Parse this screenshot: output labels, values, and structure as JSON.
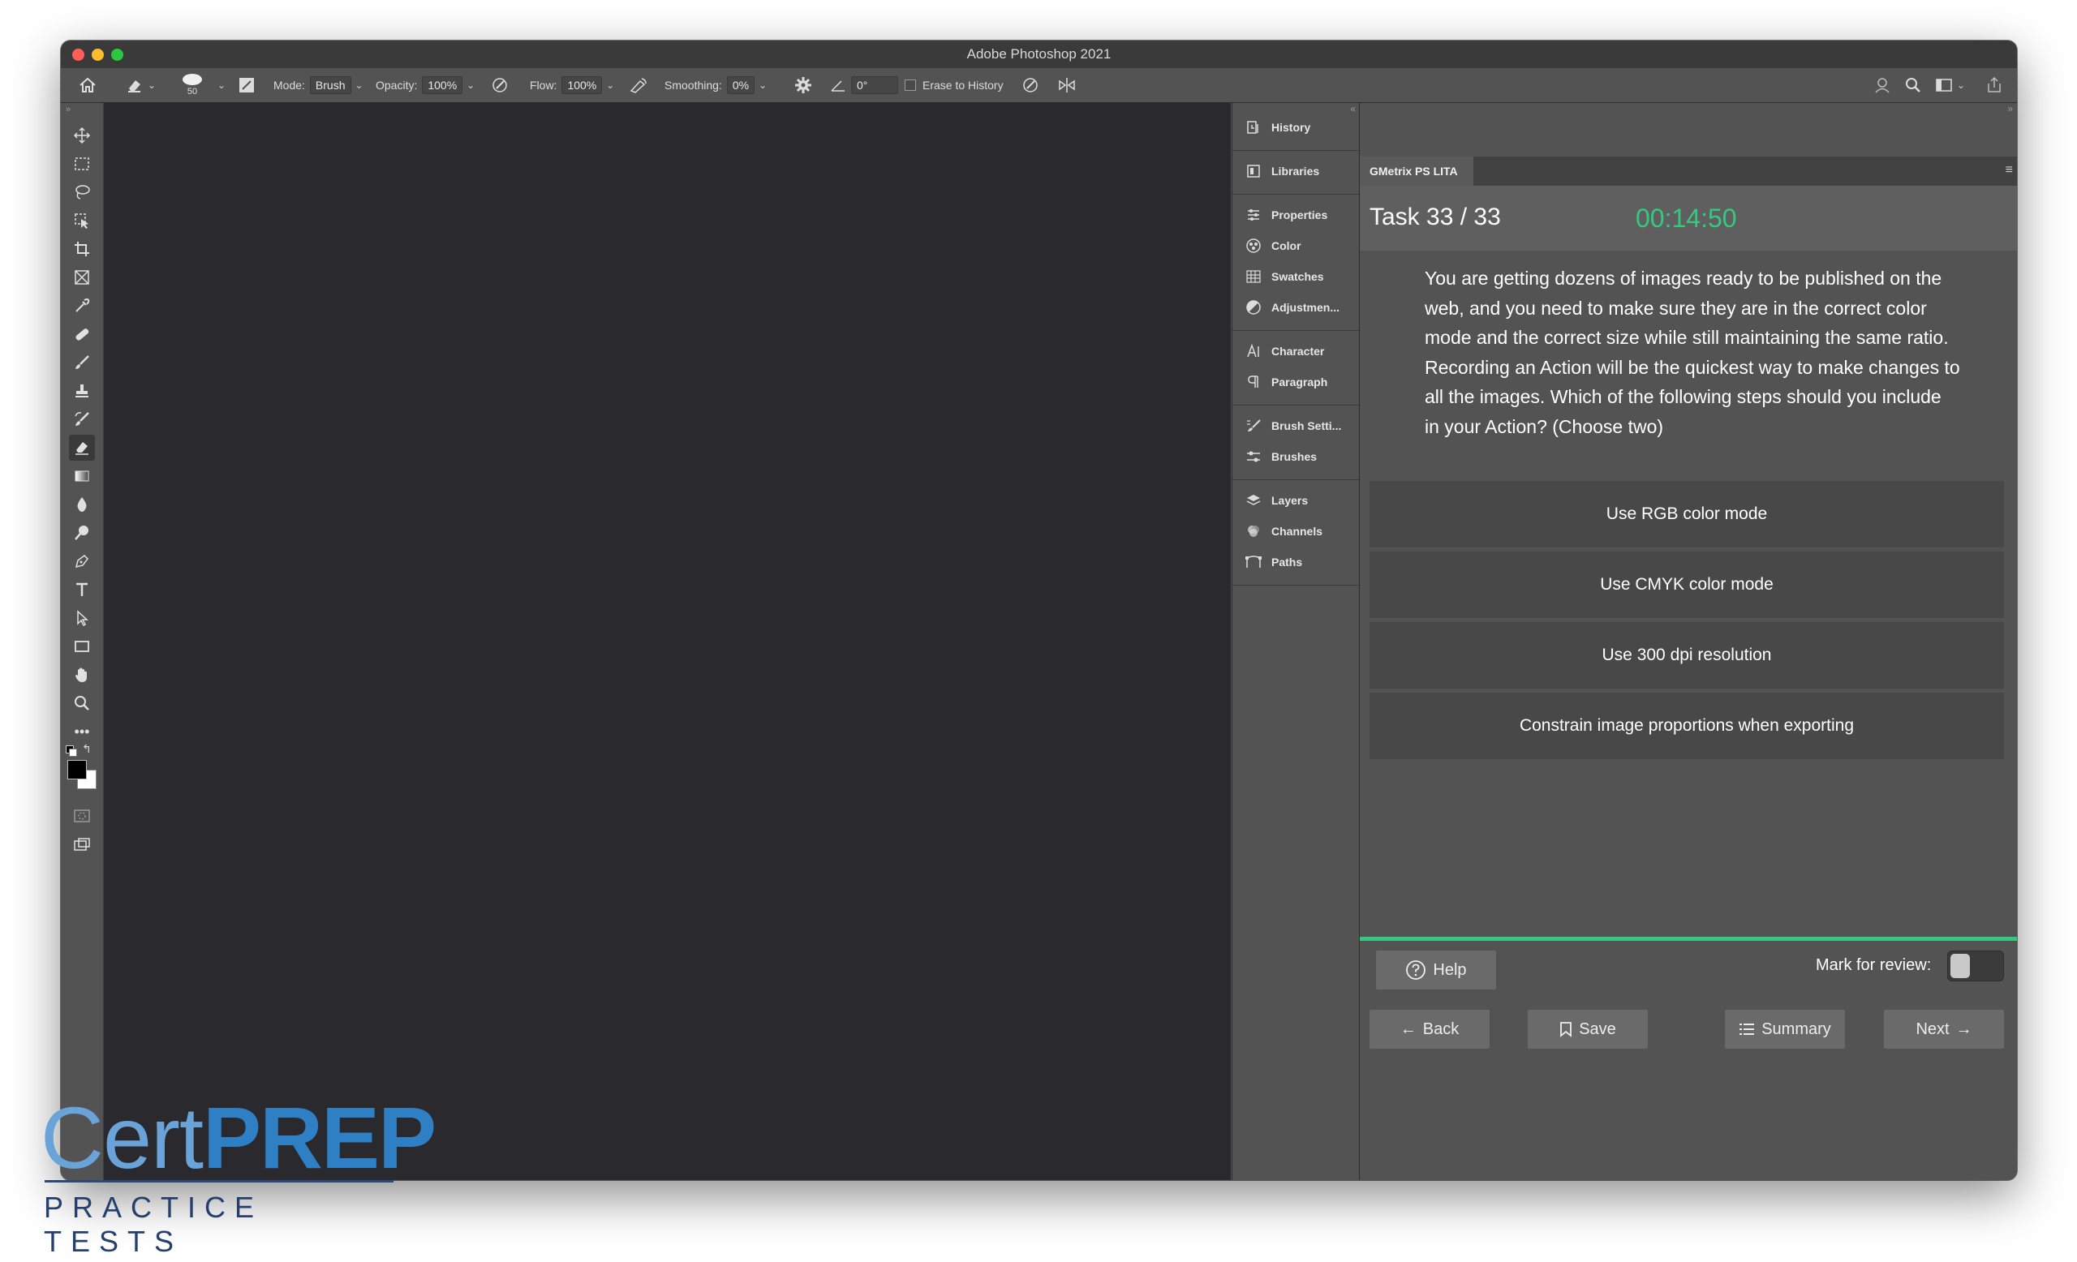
{
  "window": {
    "title": "Adobe Photoshop 2021"
  },
  "options_bar": {
    "brush_size": "50",
    "mode_label": "Mode:",
    "mode_value": "Brush",
    "opacity_label": "Opacity:",
    "opacity_value": "100%",
    "flow_label": "Flow:",
    "flow_value": "100%",
    "smoothing_label": "Smoothing:",
    "smoothing_value": "0%",
    "angle_value": "0°",
    "erase_to_history_label": "Erase to History"
  },
  "panel_dock": {
    "items": [
      {
        "label": "History",
        "icon": "history-icon"
      },
      {
        "label": "Libraries",
        "icon": "libraries-icon"
      },
      {
        "label": "Properties",
        "icon": "properties-icon"
      },
      {
        "label": "Color",
        "icon": "color-icon"
      },
      {
        "label": "Swatches",
        "icon": "swatches-icon"
      },
      {
        "label": "Adjustmen...",
        "icon": "adjustments-icon"
      },
      {
        "label": "Character",
        "icon": "character-icon"
      },
      {
        "label": "Paragraph",
        "icon": "paragraph-icon"
      },
      {
        "label": "Brush Setti...",
        "icon": "brush-settings-icon"
      },
      {
        "label": "Brushes",
        "icon": "brushes-icon"
      },
      {
        "label": "Layers",
        "icon": "layers-icon"
      },
      {
        "label": "Channels",
        "icon": "channels-icon"
      },
      {
        "label": "Paths",
        "icon": "paths-icon"
      }
    ]
  },
  "gmetrix": {
    "tab_label": "GMetrix PS LITA",
    "task_label": "Task 33 / 33",
    "timer": "00:14:50",
    "question": "You are getting dozens of images ready to be published on the web, and you need to make sure they are in the correct color mode and the correct size while still maintaining the same ratio. Recording an Action will be the quickest way to make changes to all the images. Which of the following steps should you include in your Action? (Choose two)",
    "answers": [
      "Use RGB color mode",
      "Use CMYK color mode",
      "Use 300 dpi resolution",
      "Constrain image proportions when exporting"
    ],
    "help_label": "Help",
    "mark_for_review_label": "Mark for review:",
    "mark_for_review_checked": false,
    "back_label": "Back",
    "save_label": "Save",
    "summary_label": "Summary",
    "next_label": "Next",
    "accent_color": "#35c980"
  },
  "logo": {
    "cert": "Cert",
    "prep": "PREP",
    "subtitle": "PRACTICE TESTS"
  }
}
